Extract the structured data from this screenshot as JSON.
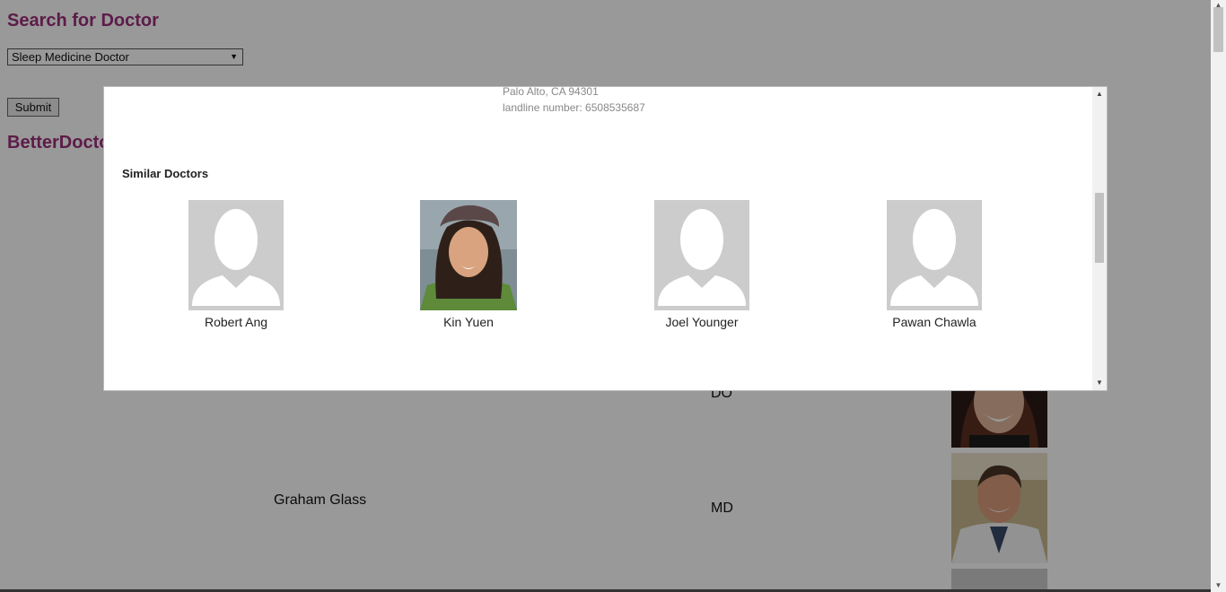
{
  "page": {
    "title": "Search for Doctor",
    "specialty_selected": "Sleep Medicine Doctor",
    "submit_label": "Submit",
    "brand": "BetterDoctor",
    "rows": [
      {
        "name": "",
        "degree": "DO"
      },
      {
        "name": "Graham Glass",
        "degree": "MD"
      }
    ]
  },
  "modal": {
    "address_line": "Palo Alto, CA 94301",
    "phone_line": "landline number: 6508535687",
    "similar_title": "Similar Doctors",
    "similar_doctors": [
      {
        "name": "Robert Ang",
        "photo": "placeholder-avatar"
      },
      {
        "name": "Kin Yuen",
        "photo": "portrait"
      },
      {
        "name": "Joel Younger",
        "photo": "placeholder-avatar"
      },
      {
        "name": "Pawan Chawla",
        "photo": "placeholder-avatar"
      }
    ]
  },
  "colors": {
    "heading": "#9b2f7a",
    "overlay": "rgba(0,0,0,0.4)",
    "placeholder_bg": "#cccccc"
  },
  "icons": {
    "select_arrow": "chevron-down-icon",
    "scroll_up": "scroll-up-arrow-icon",
    "scroll_down": "scroll-down-arrow-icon",
    "avatar": "user-silhouette-icon"
  }
}
